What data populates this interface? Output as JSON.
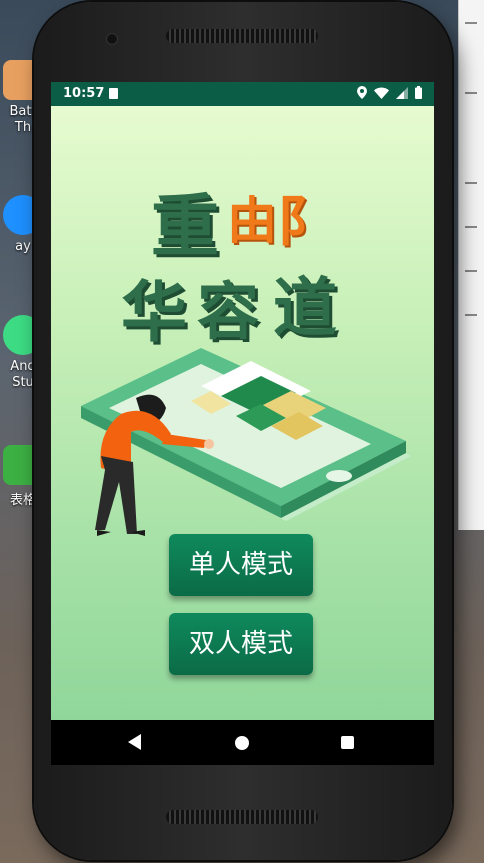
{
  "desktop": {
    "icons": [
      {
        "label": "Batt\nTh",
        "color": "#e8a060"
      },
      {
        "label": "ay",
        "color": "#1e90ff"
      },
      {
        "label": "And\nStu",
        "color": "#3ddc84"
      },
      {
        "label": "表格",
        "color": "#3cb043"
      }
    ]
  },
  "status_bar": {
    "time": "10:57"
  },
  "app": {
    "title_line1": [
      "重",
      "由",
      "阝"
    ],
    "title_line2": [
      "华",
      "容",
      "道"
    ],
    "single_player_label": "单人模式",
    "two_player_label": "双人模式"
  },
  "colors": {
    "primary_green": "#0b6b47",
    "status_bar": "#0b5e45",
    "title_orange": "#f07a1a",
    "title_green": "#2e6e4a"
  }
}
